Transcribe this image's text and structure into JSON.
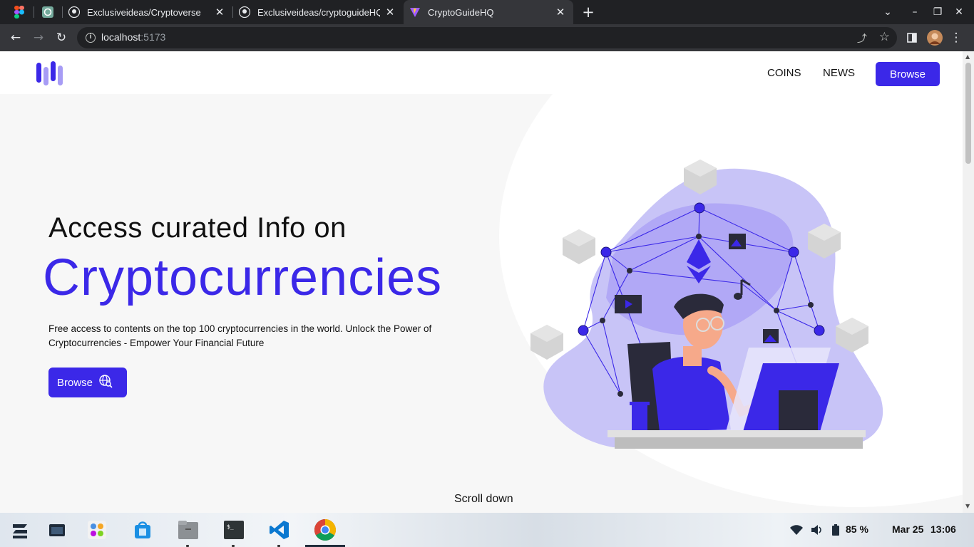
{
  "browser": {
    "tabs": [
      {
        "title": "Exclusiveideas/Cryptoverse"
      },
      {
        "title": "Exclusiveideas/cryptoguideHQ"
      },
      {
        "title": "CryptoGuideHQ",
        "active": true
      }
    ],
    "url_host": "localhost",
    "url_port": ":5173"
  },
  "nav": {
    "links": [
      "COINS",
      "NEWS"
    ],
    "browse_label": "Browse"
  },
  "hero": {
    "heading_line1": "Access curated Info on",
    "heading_line2": "Cryptocurrencies",
    "description": "Free access to contents on the top 100 cryptocurrencies in the world. Unlock the Power of Cryptocurrencies - Empower Your Financial Future",
    "browse_label": "Browse",
    "scroll_hint": "Scroll down"
  },
  "colors": {
    "accent": "#3b28e8",
    "accent_light": "#c8c4f7"
  },
  "taskbar": {
    "battery": "85 %",
    "date": "Mar 25",
    "time": "13:06",
    "apps": [
      "zorin-menu-icon",
      "files-icon",
      "software-icon",
      "store-icon",
      "file-manager-icon",
      "terminal-icon",
      "vscode-icon",
      "chrome-icon"
    ]
  }
}
